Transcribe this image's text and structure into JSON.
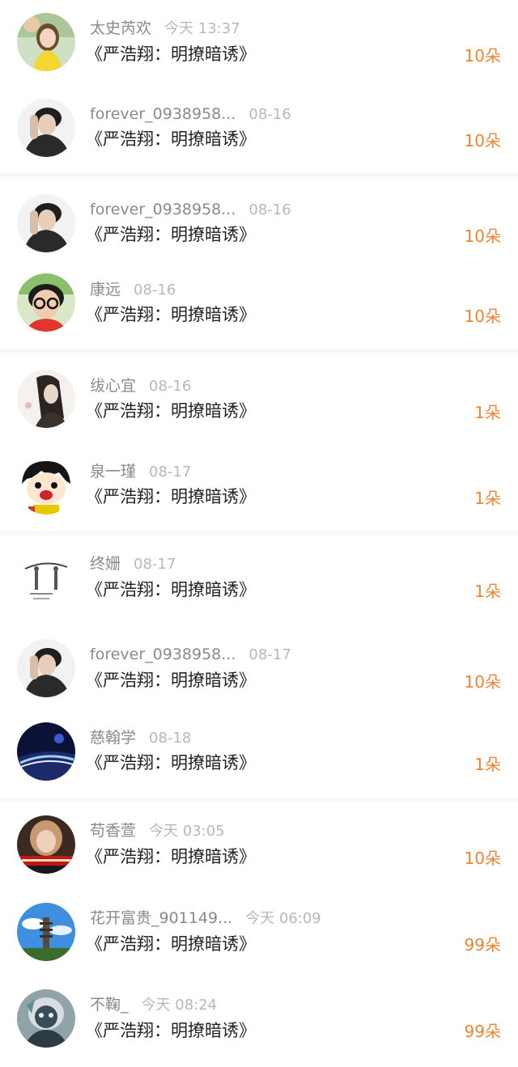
{
  "items": [
    {
      "name": "太史芮欢",
      "time": "今天 13:37",
      "title": "《严浩翔：明撩暗诱》",
      "amount": "10朵",
      "avatar": "avatar-girl-yellow-dress"
    },
    {
      "name": "forever_0938958...",
      "time": "08-16",
      "title": "《严浩翔：明撩暗诱》",
      "amount": "10朵",
      "avatar": "avatar-boy-dark"
    },
    {
      "name": "forever_0938958...",
      "time": "08-16",
      "title": "《严浩翔：明撩暗诱》",
      "amount": "10朵",
      "avatar": "avatar-boy-dark"
    },
    {
      "name": "康远",
      "time": "08-16",
      "title": "《严浩翔：明撩暗诱》",
      "amount": "10朵",
      "avatar": "avatar-kid-glasses"
    },
    {
      "name": "绂心宜",
      "time": "08-16",
      "title": "《严浩翔：明撩暗诱》",
      "amount": "1朵",
      "avatar": "avatar-woman-longhair"
    },
    {
      "name": "泉一瑾",
      "time": "08-17",
      "title": "《严浩翔：明撩暗诱》",
      "amount": "1朵",
      "avatar": "avatar-cartoon-girl"
    },
    {
      "name": "终姗",
      "time": "08-17",
      "title": "《严浩翔：明撩暗诱》",
      "amount": "1朵",
      "avatar": "avatar-sketch"
    },
    {
      "name": "forever_0938958...",
      "time": "08-17",
      "title": "《严浩翔：明撩暗诱》",
      "amount": "10朵",
      "avatar": "avatar-boy-dark"
    },
    {
      "name": "慈翰学",
      "time": "08-18",
      "title": "《严浩翔：明撩暗诱》",
      "amount": "1朵",
      "avatar": "avatar-night-road"
    },
    {
      "name": "苟香萱",
      "time": "今天 03:05",
      "title": "《严浩翔：明撩暗诱》",
      "amount": "10朵",
      "avatar": "avatar-woman-red-banner"
    },
    {
      "name": "花开富贵_901149...",
      "time": "今天 06:09",
      "title": "《严浩翔：明撩暗诱》",
      "amount": "99朵",
      "avatar": "avatar-pagoda-sky"
    },
    {
      "name": "不鞠_",
      "time": "今天 08:24",
      "title": "《严浩翔：明撩暗诱》",
      "amount": "99朵",
      "avatar": "avatar-masked-figure"
    }
  ],
  "colors": {
    "amount": "#f08433",
    "name": "#8a8a8a",
    "time": "#b8b8b8",
    "title": "#222222"
  }
}
